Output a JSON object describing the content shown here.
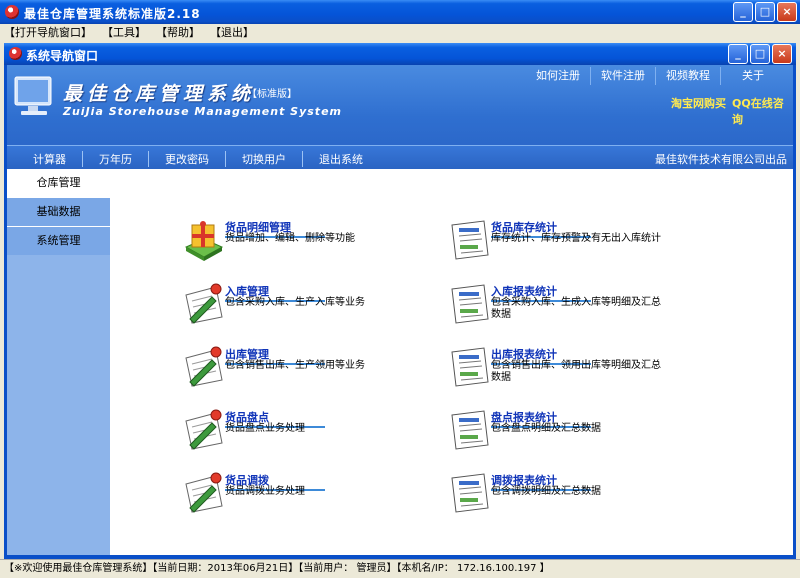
{
  "window": {
    "title": "最佳仓库管理系统标准版2.18"
  },
  "menubar": [
    "【打开导航窗口】",
    "【工具】",
    "【帮助】",
    "【退出】"
  ],
  "inner_window": {
    "title": "系统导航窗口"
  },
  "banner": {
    "title_cn": "最佳仓库管理系统",
    "edition": "【标准版】",
    "title_en": "ZuiJia Storehouse Management System",
    "top_nav": [
      "如何注册",
      "软件注册",
      "视频教程",
      "关于"
    ],
    "link_shop": "淘宝网购买",
    "link_qq": "QQ在线咨询"
  },
  "navbar": {
    "items": [
      "计算器",
      "万年历",
      "更改密码",
      "切换用户",
      "退出系统"
    ],
    "company": "最佳软件技术有限公司出品"
  },
  "sidebar": {
    "items": [
      {
        "label": "仓库管理"
      },
      {
        "label": "基础数据"
      },
      {
        "label": "系统管理"
      }
    ]
  },
  "modules": {
    "left": [
      {
        "label": "货品明细管理",
        "desc": "货品增加、编辑、删除等功能",
        "icon": "gift-box-icon"
      },
      {
        "label": "入库管理",
        "desc": "包含采购入库、生产入库等业务",
        "icon": "pin-edit-icon"
      },
      {
        "label": "出库管理",
        "desc": "包含销售出库、生产领用等业务",
        "icon": "pin-edit-icon"
      },
      {
        "label": "货品盘点",
        "desc": "货品盘点业务处理",
        "icon": "pin-edit-icon"
      },
      {
        "label": "货品调拨",
        "desc": "货品调拨业务处理",
        "icon": "pin-edit-icon"
      }
    ],
    "right": [
      {
        "label": "货品库存统计",
        "desc": "库存统计、库存预警及有无出入库统计",
        "icon": "report-icon"
      },
      {
        "label": "入库报表统计",
        "desc": "包含采购入库、生成入库等明细及汇总数据",
        "icon": "report-icon"
      },
      {
        "label": "出库报表统计",
        "desc": "包含销售出库、领用出库等明细及汇总数据",
        "icon": "report-icon"
      },
      {
        "label": "盘点报表统计",
        "desc": "包含盘点明细及汇总数据",
        "icon": "report-icon"
      },
      {
        "label": "调拨报表统计",
        "desc": "包含调拨明细及汇总数据",
        "icon": "report-icon"
      }
    ]
  },
  "statusbar": {
    "text": "【※欢迎使用最佳仓库管理系统】【当前日期：2013年06月21日】【当前用户： 管理员】【本机名/IP： 172.16.100.197 】"
  }
}
